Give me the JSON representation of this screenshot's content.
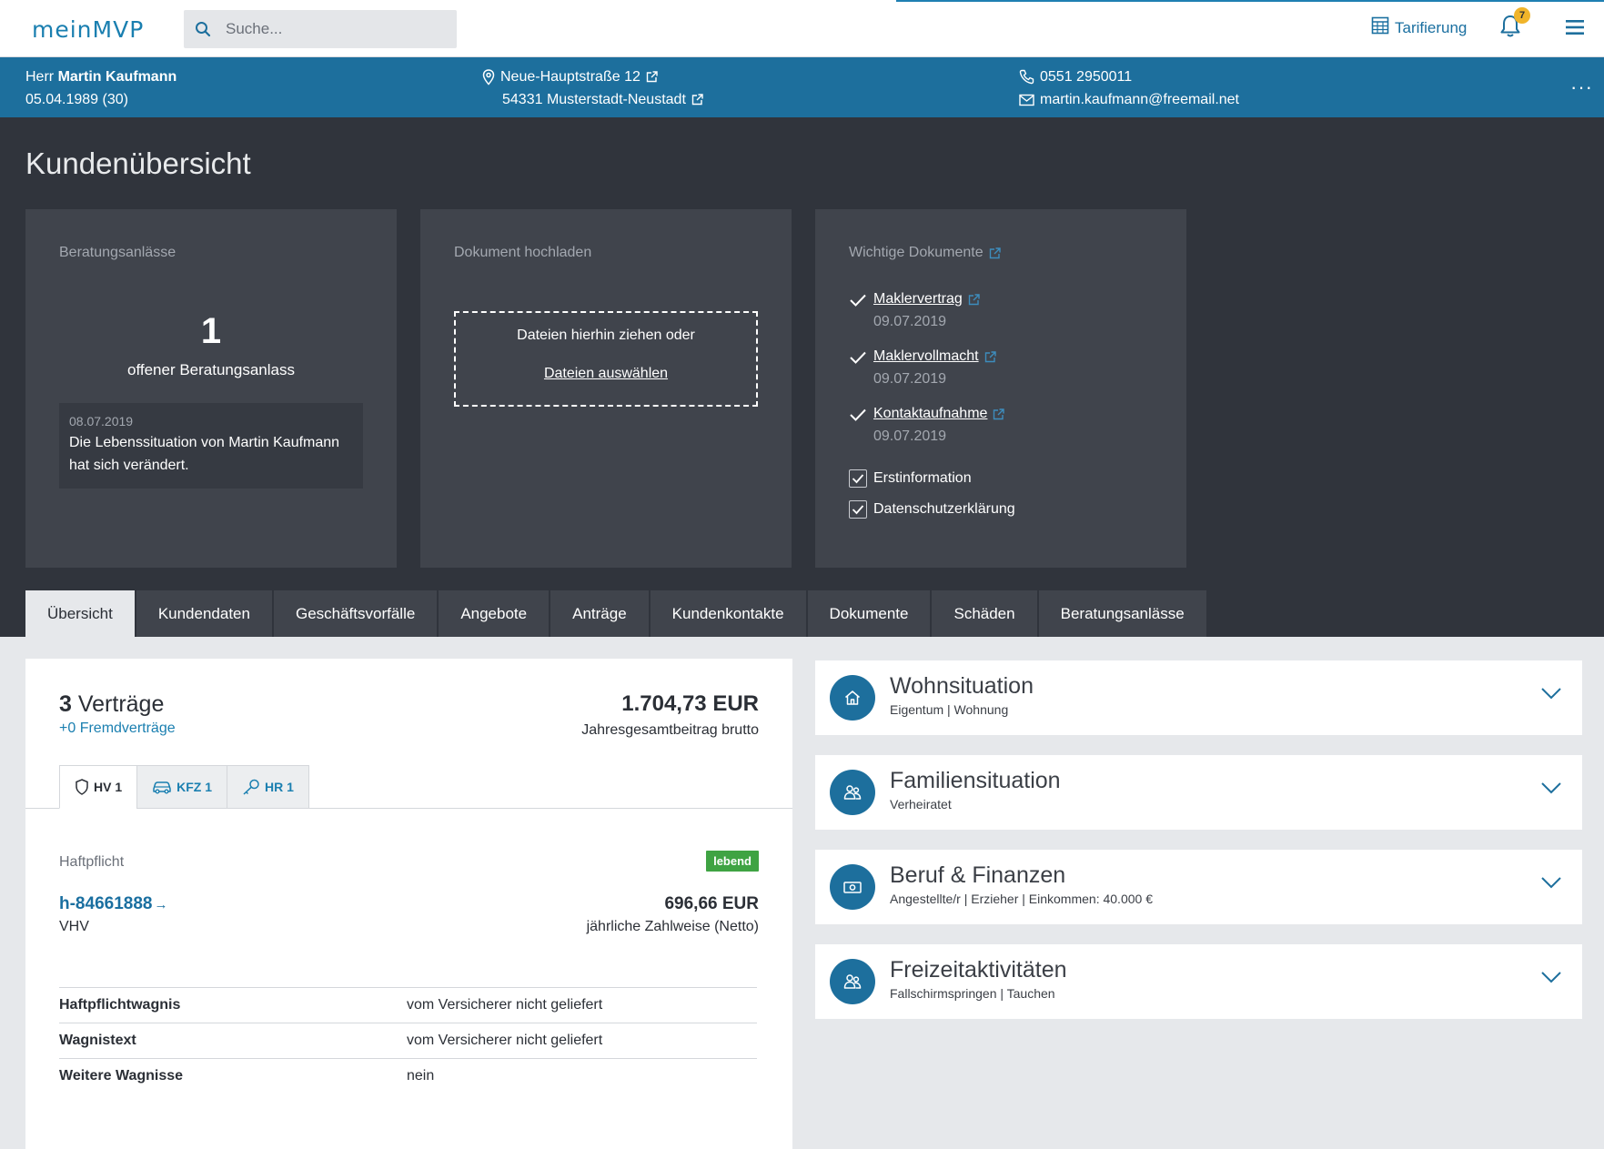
{
  "app": {
    "logo": "meinMVP"
  },
  "topbar": {
    "search_placeholder": "Suche...",
    "tarif_label": "Tarifierung",
    "notification_count": "7"
  },
  "customer": {
    "salutation": "Herr",
    "name": "Martin Kaufmann",
    "birth": "05.04.1989 (30)",
    "street": "Neue-Hauptstraße 12",
    "city": "54331 Musterstadt-Neustadt",
    "phone": "0551 2950011",
    "email": "martin.kaufmann@freemail.net",
    "more": "···"
  },
  "page": {
    "title": "Kundenübersicht"
  },
  "cards": {
    "consult": {
      "title": "Beratungsanlässe",
      "count": "1",
      "count_label": "offener Beratungsanlass",
      "event_date": "08.07.2019",
      "event_text": "Die Lebenssituation von Martin Kaufmann hat sich verändert."
    },
    "upload": {
      "title": "Dokument hochladen",
      "drop_text": "Dateien hierhin ziehen oder",
      "select_link": "Dateien auswählen"
    },
    "docs": {
      "title": "Wichtige Dokumente",
      "items": [
        {
          "label": "Maklervertrag",
          "date": "09.07.2019"
        },
        {
          "label": "Maklervollmacht",
          "date": "09.07.2019"
        },
        {
          "label": "Kontaktaufnahme",
          "date": "09.07.2019"
        }
      ],
      "checkboxes": [
        {
          "label": "Erstinformation",
          "checked": true
        },
        {
          "label": "Datenschutzerklärung",
          "checked": true
        }
      ]
    }
  },
  "tabs": [
    "Übersicht",
    "Kundendaten",
    "Geschäftsvorfälle",
    "Angebote",
    "Anträge",
    "Kundenkontakte",
    "Dokumente",
    "Schäden",
    "Beratungsanlässe"
  ],
  "contracts": {
    "count": "3",
    "count_label": "Verträge",
    "foreign": "+0 Fremdverträge",
    "total": "1.704,73 EUR",
    "total_label": "Jahresgesamtbeitrag brutto",
    "contract_tabs": [
      {
        "icon": "shield-icon",
        "label": "HV 1"
      },
      {
        "icon": "car-icon",
        "label": "KFZ 1"
      },
      {
        "icon": "key-icon",
        "label": "HR 1"
      }
    ],
    "section": "Haftpflicht",
    "status": "lebend",
    "policy_number": "h-84661888",
    "insurer": "VHV",
    "premium": "696,66 EUR",
    "premium_label": "jährliche Zahlweise (Netto)",
    "details": [
      {
        "key": "Haftpflichtwagnis",
        "value": "vom Versicherer nicht geliefert"
      },
      {
        "key": "Wagnistext",
        "value": "vom Versicherer nicht geliefert"
      },
      {
        "key": "Weitere Wagnisse",
        "value": "nein"
      }
    ]
  },
  "situations": [
    {
      "icon": "house-icon",
      "title": "Wohnsituation",
      "subtitle": "Eigentum | Wohnung"
    },
    {
      "icon": "people-icon",
      "title": "Familiensituation",
      "subtitle": "Verheiratet"
    },
    {
      "icon": "money-icon",
      "title": "Beruf & Finanzen",
      "subtitle": "Angestellte/r | Erzieher | Einkommen: 40.000 €"
    },
    {
      "icon": "activity-icon",
      "title": "Freizeitaktivitäten",
      "subtitle": "Fallschirmspringen | Tauchen"
    }
  ],
  "colors": {
    "brand": "#1d6f9d",
    "dark_bg": "#30343c",
    "card_bg": "#40444c",
    "status_green": "#3fa343",
    "badge": "#f0b42a"
  }
}
